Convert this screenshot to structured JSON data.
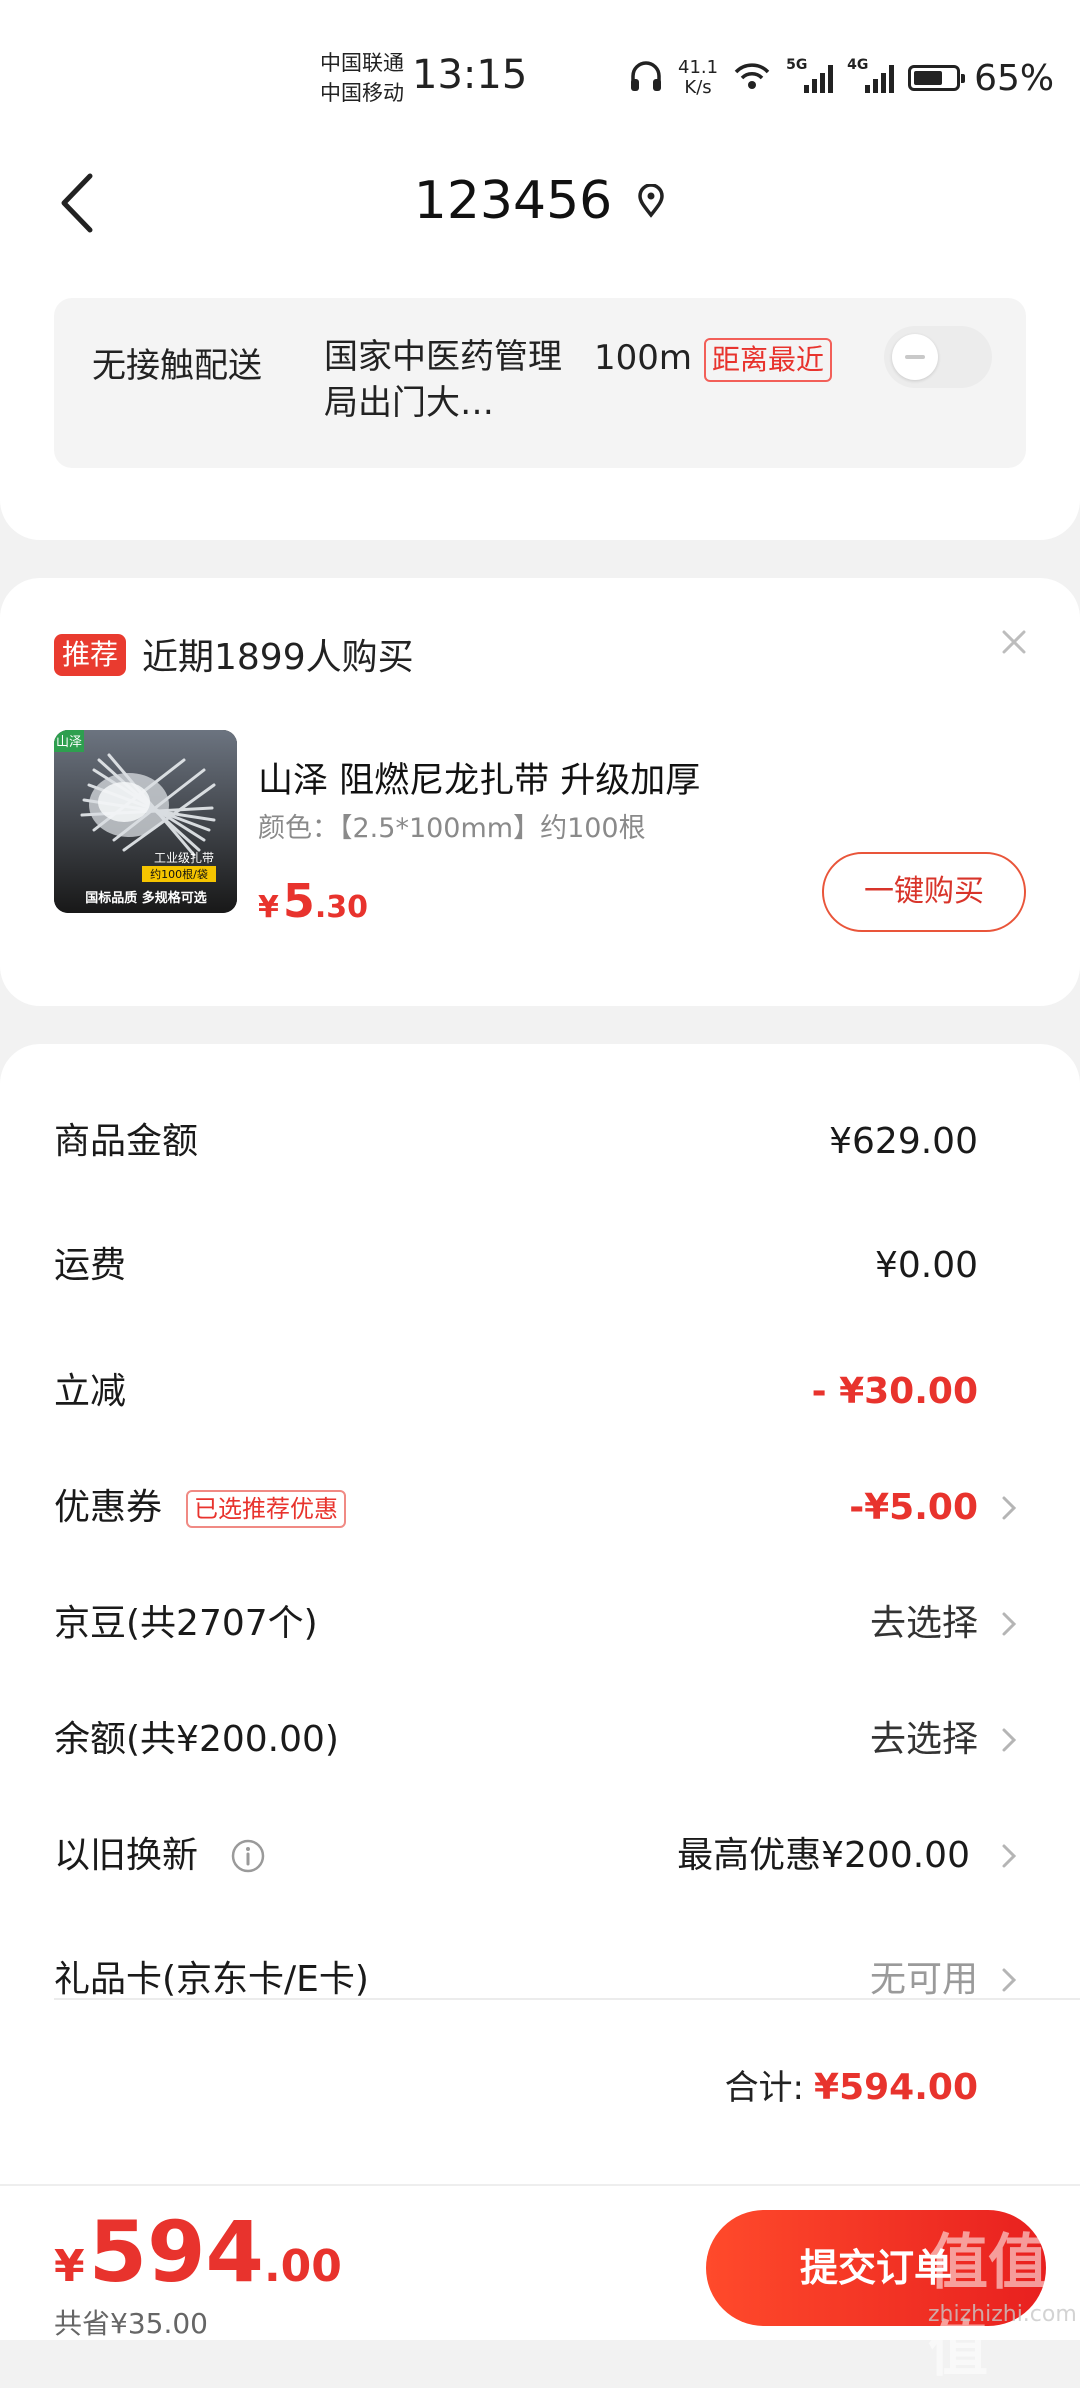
{
  "status_bar": {
    "carrier1": "中国联通",
    "carrier2": "中国移动",
    "time": "13:15",
    "speed_value": "41.1",
    "speed_unit": "K/s",
    "net1": "5G",
    "net2": "4G",
    "battery": "65%"
  },
  "header": {
    "title": "123456",
    "back_icon": "chevron-left-icon",
    "location_icon": "location-pin-icon"
  },
  "delivery": {
    "label": "无接触配送",
    "address": "国家中医药管理局出门大…",
    "distance": "100m",
    "badge": "距离最近",
    "toggle_on": false
  },
  "recommendation": {
    "tag": "推荐",
    "text": "近期1899人购买",
    "product": {
      "title": "山泽 阻燃尼龙扎带 升级加厚",
      "spec": "颜色：【2.5*100mm】约100根",
      "price_symbol": "¥",
      "price_int": "5",
      "price_dec": ".30",
      "buy_label": "一键购买",
      "image_brand": "山泽",
      "image_line1": "工业级扎带",
      "image_line2": "约100根/袋",
      "image_line3": "国标品质 多规格可选"
    }
  },
  "summary": {
    "rows": [
      {
        "label": "商品金额",
        "value": "¥629.00"
      },
      {
        "label": "运费",
        "value": "¥0.00"
      },
      {
        "label": "立减",
        "value": "- ¥30.00"
      },
      {
        "label": "优惠券",
        "tag": "已选推荐优惠",
        "value": "-¥5.00"
      },
      {
        "label": "京豆(共2707个)",
        "value": "去选择"
      },
      {
        "label": "余额(共¥200.00)",
        "value": "去选择"
      },
      {
        "label": "以旧换新",
        "value": "最高优惠¥200.00"
      },
      {
        "label": "礼品卡(京东卡/E卡)",
        "value": "无可用"
      }
    ],
    "total_label": "合计:",
    "total_value": "¥594.00"
  },
  "bottom_bar": {
    "price_symbol": "¥",
    "price_int": "594",
    "price_dec": ".00",
    "saved": "共省¥35.00",
    "submit_label": "提交订单",
    "watermark": "值值值",
    "watermark_sub": "zhizhizhi.com"
  },
  "colors": {
    "accent_red": "#e8332d",
    "background": "#f2f2f2",
    "card": "#ffffff"
  }
}
